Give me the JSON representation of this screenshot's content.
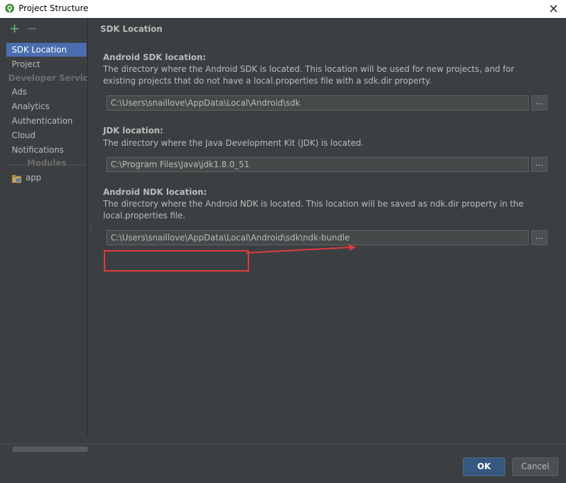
{
  "window": {
    "title": "Project Structure",
    "icon": "android-studio-icon",
    "close_glyph": "✕"
  },
  "sidebar": {
    "add_glyph": "+",
    "remove_glyph": "−",
    "items": [
      {
        "label": "SDK Location",
        "selected": true
      },
      {
        "label": "Project"
      }
    ],
    "developer_services_header": "Developer Services",
    "developer_services": [
      {
        "label": "Ads"
      },
      {
        "label": "Analytics"
      },
      {
        "label": "Authentication"
      },
      {
        "label": "Cloud"
      },
      {
        "label": "Notifications"
      }
    ],
    "modules_header": "Modules",
    "modules": [
      {
        "label": "app",
        "icon": "module-folder-icon"
      }
    ]
  },
  "main": {
    "section_title": "SDK Location",
    "android_sdk": {
      "label": "Android SDK location:",
      "description": "The directory where the Android SDK is located. This location will be used for new projects, and for existing projects that do not have a local.properties file with a sdk.dir property.",
      "path": "C:\\Users\\snaillove\\AppData\\Local\\Android\\sdk",
      "browse_label": "..."
    },
    "jdk": {
      "label": "JDK location:",
      "description": "The directory where the Java Development Kit (JDK) is located.",
      "path": "C:\\Program Files\\Java\\jdk1.8.0_51",
      "browse_label": "..."
    },
    "android_ndk": {
      "label": "Android NDK location:",
      "description": "The directory where the Android NDK is located. This location will be saved as ndk.dir property in the local.properties file.",
      "path": "C:\\Users\\snaillove\\AppData\\Local\\Android\\sdk\\ndk-bundle",
      "browse_label": "..."
    }
  },
  "footer": {
    "ok_label": "OK",
    "cancel_label": "Cancel"
  },
  "colors": {
    "background": "#3c3f41",
    "selection": "#4b6eaf",
    "annotation_red": "#e23b3b",
    "ok_button": "#365880"
  }
}
